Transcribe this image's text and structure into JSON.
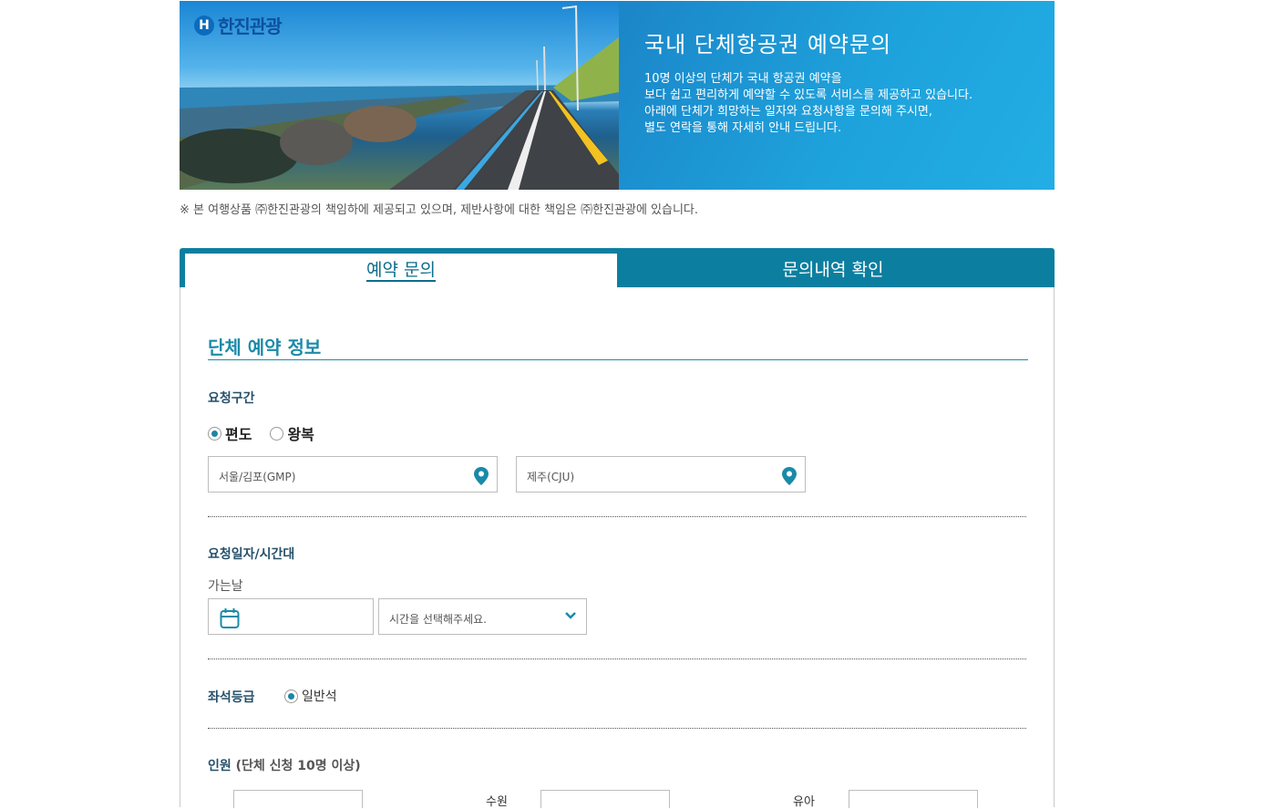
{
  "banner": {
    "logo_mark": "H",
    "logo_text": "한진관광",
    "title": "국내 단체항공권 예약문의",
    "desc_lines": [
      "10명 이상의 단체가 국내 항공권 예약을",
      "보다 쉽고 편리하게 예약할 수 있도록 서비스를 제공하고 있습니다.",
      "아래에 단체가 희망하는 일자와 요청사항을 문의해 주시면,",
      "별도 연락을 통해 자세히 안내 드립니다."
    ]
  },
  "notice": "※ 본 여행상품 ㈜한진관광의 책임하에 제공되고 있으며, 제반사항에 대한 책임은 ㈜한진관광에 있습니다.",
  "tabs": {
    "reserve": "예약 문의",
    "history": "문의내역 확인"
  },
  "form": {
    "section_title": "단체 예약 정보",
    "route_label": "요청구간",
    "trip_type": {
      "oneway": "편도",
      "roundtrip": "왕복",
      "selected": "편도"
    },
    "departure": "서울/김포(GMP)",
    "arrival": "제주(CJU)",
    "date_label": "요청일자/시간대",
    "depart_day_label": "가는날",
    "date_value": "",
    "time_placeholder": "시간을 선택해주세요.",
    "seat_label": "좌석등급",
    "seat_option": "일반석",
    "people_label": "인원",
    "people_note": "(단체 신청 10명 이상)",
    "people_fields": [
      "수원",
      "유아"
    ]
  },
  "colors": {
    "accent": "#1c8ba9",
    "tab_bar": "#0c7fa0",
    "banner_blue": "#1ea2dc"
  },
  "icons": {
    "pin": "map-pin-icon",
    "calendar": "calendar-icon",
    "chevron": "chevron-down-icon"
  }
}
